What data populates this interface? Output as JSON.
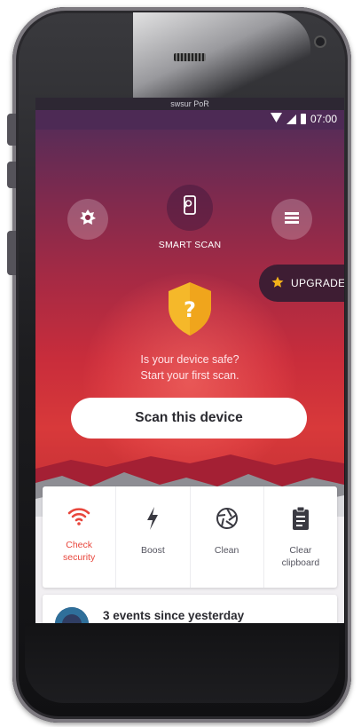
{
  "device": {
    "top_label": "swsur PoR"
  },
  "status_bar": {
    "time": "07:00"
  },
  "header": {
    "left_icon": "antivirus-icon",
    "center_icon": "phone-scan-icon",
    "right_icon": "menu-list-icon",
    "smart_scan_label": "SMART SCAN"
  },
  "upgrade": {
    "label": "UPGRADE",
    "icon": "star-icon",
    "color": "#f3b21a"
  },
  "hero": {
    "shield_symbol": "?",
    "line1": "Is your device safe?",
    "line2": "Start your first scan.",
    "scan_button": "Scan this device"
  },
  "features": [
    {
      "label": "Check\nsecurity",
      "icon": "wifi-icon",
      "active": true
    },
    {
      "label": "Boost",
      "icon": "lightning-icon",
      "active": false
    },
    {
      "label": "Clean",
      "icon": "aperture-icon",
      "active": false
    },
    {
      "label": "Clear\nclipboard",
      "icon": "clipboard-icon",
      "active": false
    }
  ],
  "events": {
    "title": "3 events since yesterday"
  },
  "colors": {
    "accent": "#e8463c",
    "hero_top": "#5a2c57",
    "hero_bottom": "#d8393a",
    "shield": "#f5b82a"
  }
}
